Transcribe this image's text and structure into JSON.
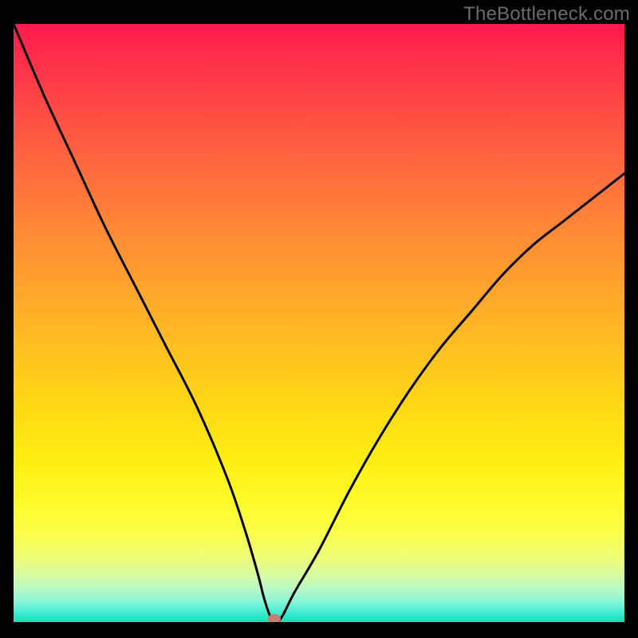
{
  "watermark": "TheBottleneck.com",
  "chart_data": {
    "type": "line",
    "title": "",
    "xlabel": "",
    "ylabel": "",
    "xlim": [
      0,
      100
    ],
    "ylim": [
      0,
      100
    ],
    "series": [
      {
        "name": "curve",
        "x": [
          0,
          5,
          10,
          15,
          20,
          25,
          30,
          35,
          38,
          40,
          41,
          42,
          43,
          44,
          46,
          50,
          55,
          60,
          65,
          70,
          75,
          80,
          85,
          90,
          95,
          100
        ],
        "values": [
          100,
          88,
          77,
          66,
          56,
          46,
          36,
          24,
          15,
          8,
          4,
          1,
          0,
          1,
          5,
          12,
          22,
          31,
          39,
          46,
          52,
          58,
          63,
          67,
          71,
          75
        ]
      }
    ],
    "marker": {
      "x": 42.7,
      "y": 0.5
    },
    "gradient_stops": [
      {
        "pos": 0,
        "color": "#ff1a4d"
      },
      {
        "pos": 0.5,
        "color": "#ffd014"
      },
      {
        "pos": 1.0,
        "color": "#18dfb4"
      }
    ]
  }
}
